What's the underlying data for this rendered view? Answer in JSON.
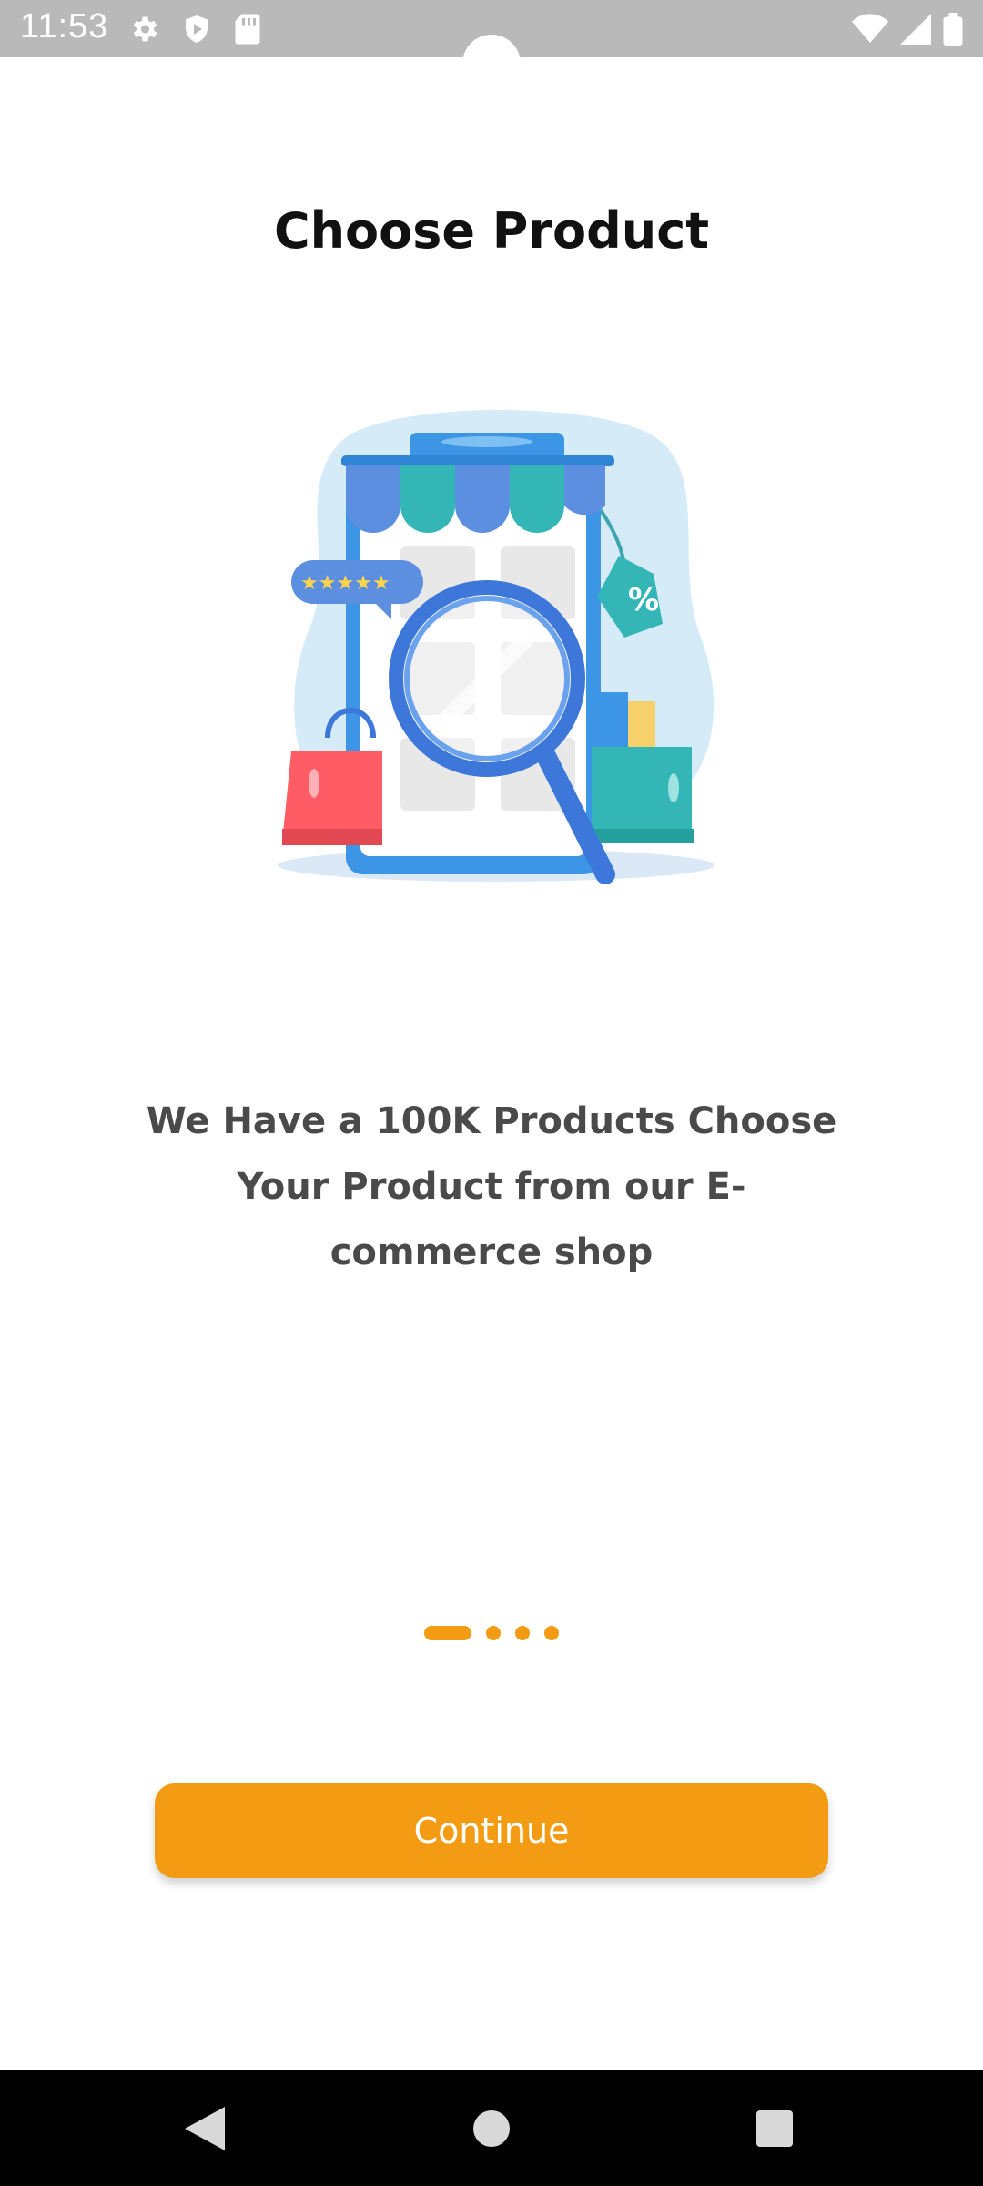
{
  "status_bar": {
    "time": "11:53",
    "left_icons": [
      "gear-icon",
      "shield-play-icon",
      "sd-card-icon"
    ],
    "right_icons": [
      "wifi-icon",
      "signal-icon",
      "battery-icon"
    ]
  },
  "onboarding": {
    "title": "Choose Product",
    "illustration_icon": "shop-search-illustration",
    "description": "We Have a 100K Products Choose Your Product from our E-commerce shop",
    "pager": {
      "total": 4,
      "current": 1
    },
    "continue_label": "Continue"
  },
  "nav_bar": {
    "icons": [
      "back-icon",
      "home-icon",
      "recents-icon"
    ]
  },
  "colors": {
    "accent": "#f29b13",
    "title_text": "#111111",
    "body_text": "#4a4a4a",
    "status_bar": "#b9b9b9"
  }
}
